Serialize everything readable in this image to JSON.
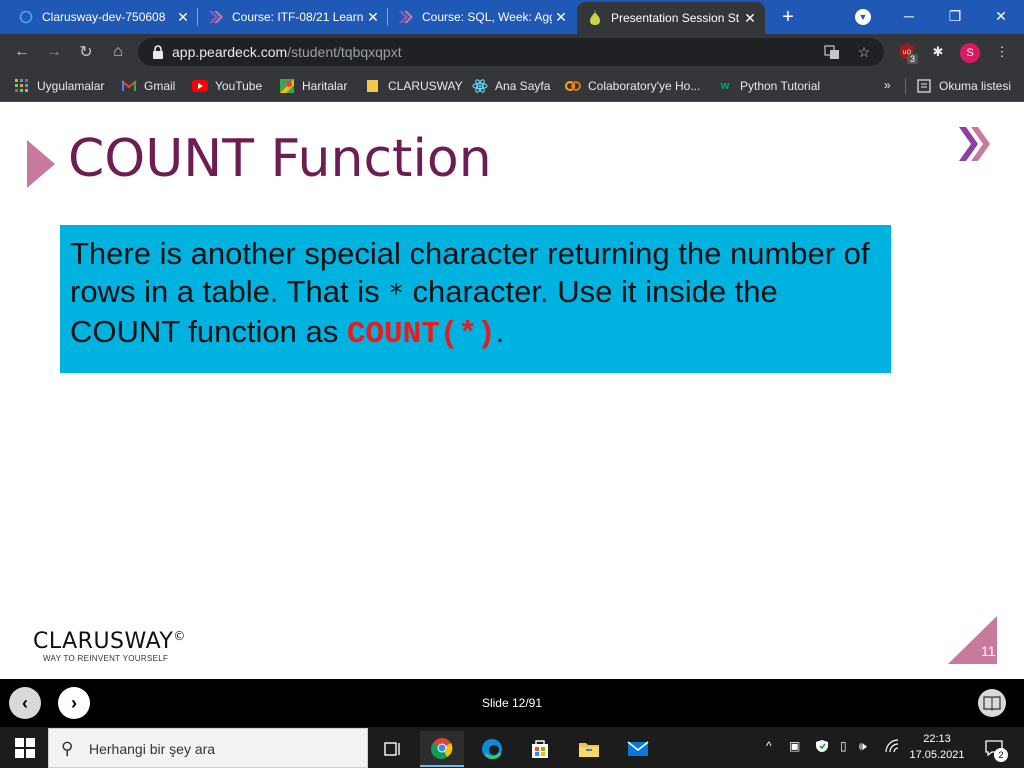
{
  "browser": {
    "tabs": [
      {
        "title": "Clarusway-dev-750608",
        "favicon": "circle-icon",
        "active": false
      },
      {
        "title": "Course: ITF-08/21 Learn",
        "favicon": "clarusway-chevron-icon",
        "active": false
      },
      {
        "title": "Course: SQL, Week: Agg",
        "favicon": "clarusway-chevron-icon",
        "active": false
      },
      {
        "title": "Presentation Session St",
        "favicon": "pear-icon",
        "active": true
      }
    ],
    "new_tab_label": "+",
    "url_domain": "app.peardeck.com",
    "url_path": "/student/tqbqxqpxt",
    "profile_initial": "S",
    "extension_badge": "3"
  },
  "bookmarks": [
    {
      "label": "Uygulamalar",
      "icon": "apps-grid-icon"
    },
    {
      "label": "Gmail",
      "icon": "gmail-icon"
    },
    {
      "label": "YouTube",
      "icon": "youtube-icon"
    },
    {
      "label": "Haritalar",
      "icon": "maps-icon"
    },
    {
      "label": "CLARUSWAY",
      "icon": "folder-icon"
    },
    {
      "label": "Ana Sayfa",
      "icon": "react-icon"
    },
    {
      "label": "Colaboratory'ye Ho...",
      "icon": "colab-icon"
    },
    {
      "label": "Python Tutorial",
      "icon": "w3-icon"
    }
  ],
  "bookmarks_more": "»",
  "reading_list": "Okuma listesi",
  "slide": {
    "title": "COUNT Function",
    "box_text_1": "There is another special character returning the number of rows in a table. That is ",
    "box_star": "*",
    "box_text_2": " character.  Use it inside the COUNT function as ",
    "box_code": "COUNT(*)",
    "box_text_3": ".",
    "brand": "CLARUSWAY",
    "brand_mark": "©",
    "tagline": "WAY TO REINVENT YOURSELF",
    "page_number": "11",
    "accent_color": "#c8799e",
    "title_color": "#6d1d52",
    "box_color": "#00b2e0"
  },
  "peardeck": {
    "prev_label": "‹",
    "next_label": "›",
    "slide_count": "Slide 12/91"
  },
  "taskbar": {
    "search_placeholder": "Herhangi bir şey ara",
    "time": "22:13",
    "date": "17.05.2021",
    "notification_count": "2"
  }
}
